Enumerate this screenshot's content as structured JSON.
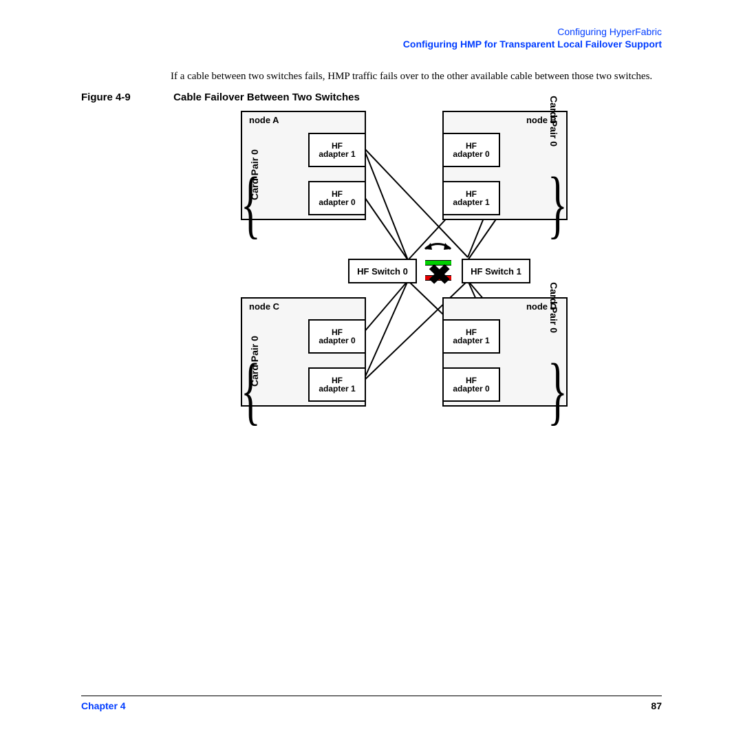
{
  "header": {
    "light": "Configuring HyperFabric",
    "bold": "Configuring HMP for Transparent Local Failover Support"
  },
  "intro": "If a cable between two switches fails, HMP traffic fails over to the other available cable between those two switches.",
  "figure": {
    "label": "Figure 4-9",
    "caption": "Cable Failover Between Two Switches"
  },
  "diagram": {
    "nodes": {
      "A": {
        "title": "node A",
        "top": {
          "l1": "HF",
          "l2": "adapter 1"
        },
        "bot": {
          "l1": "HF",
          "l2": "adapter 0"
        },
        "card_pair": "Card Pair 0"
      },
      "B": {
        "title": "node B",
        "top": {
          "l1": "HF",
          "l2": "adapter 0"
        },
        "bot": {
          "l1": "HF",
          "l2": "adapter 1"
        },
        "card_pair": "Card Pair 0"
      },
      "C": {
        "title": "node C",
        "top": {
          "l1": "HF",
          "l2": "adapter 0"
        },
        "bot": {
          "l1": "HF",
          "l2": "adapter 1"
        },
        "card_pair": "Card Pair 0"
      },
      "D": {
        "title": "node D",
        "top": {
          "l1": "HF",
          "l2": "adapter 1"
        },
        "bot": {
          "l1": "HF",
          "l2": "adapter 0"
        },
        "card_pair": "Card Pair 0"
      }
    },
    "switches": {
      "left": "HF Switch 0",
      "right": "HF Switch 1"
    },
    "fail_mark": "✖"
  },
  "footer": {
    "chapter": "Chapter 4",
    "page": "87"
  }
}
